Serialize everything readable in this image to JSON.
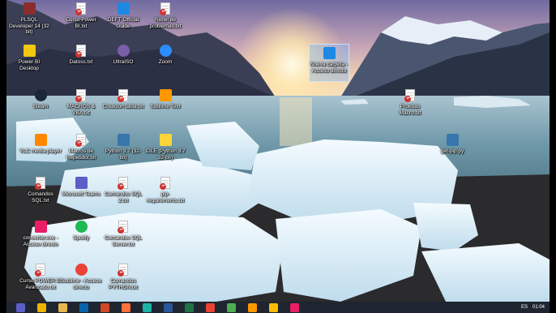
{
  "desktop_icons": [
    {
      "label": "PLSQL Developer 14 (32 bit)",
      "icon": "plsql-icon",
      "color": "#8b2d2d"
    },
    {
      "label": "Curso Power BI.txt",
      "icon": "text-file-icon",
      "color": "#d32f2f"
    },
    {
      "label": "DEFT Official Guide",
      "icon": "shortcut-icon",
      "color": "#1e88e5"
    },
    {
      "label": "Rebel de problemas.txt",
      "icon": "text-file-icon",
      "color": "#d32f2f"
    },
    {
      "label": "Power BI Desktop",
      "icon": "powerbi-icon",
      "color": "#f2c811"
    },
    {
      "label": "Datoss.txt",
      "icon": "text-file-icon",
      "color": "#d32f2f"
    },
    {
      "label": "UltraISO",
      "icon": "ultraiso-icon",
      "color": "#7b5ea7"
    },
    {
      "label": "Zoom",
      "icon": "zoom-icon",
      "color": "#2d8cff"
    },
    {
      "label": "Steam",
      "icon": "steam-icon",
      "color": "#1b2838"
    },
    {
      "label": "MACROS & VBA.txt",
      "icon": "text-file-icon",
      "color": "#d32f2f"
    },
    {
      "label": "Creacion tabla.txt",
      "icon": "text-file-icon",
      "color": "#d32f2f"
    },
    {
      "label": "Sublime Text",
      "icon": "sublime-icon",
      "color": "#ff9800"
    },
    {
      "label": "Pruebas Macro.txt",
      "icon": "text-file-icon",
      "color": "#d32f2f"
    },
    {
      "label": "VLC media player",
      "icon": "vlc-icon",
      "color": "#ff8800"
    },
    {
      "label": "Macros de Repetidor.txt",
      "icon": "text-file-icon",
      "color": "#d32f2f"
    },
    {
      "label": "Python 3.7 (32-bit)",
      "icon": "python-icon",
      "color": "#3776ab"
    },
    {
      "label": "IDLE (Python 3.7 32-bit)",
      "icon": "idle-icon",
      "color": "#ffd43b"
    },
    {
      "label": "get-pip.py",
      "icon": "python-file-icon",
      "color": "#3776ab"
    },
    {
      "label": "Comandos SQL.txt",
      "icon": "text-file-icon",
      "color": "#d32f2f"
    },
    {
      "label": "Microsoft Teams",
      "icon": "teams-icon",
      "color": "#5b5fc7"
    },
    {
      "label": "Comandos SQL 2.txt",
      "icon": "text-file-icon",
      "color": "#d32f2f"
    },
    {
      "label": "pip-requirements.txt",
      "icon": "text-file-icon",
      "color": "#d32f2f"
    },
    {
      "label": "converter.exe - Acceso directo",
      "icon": "converter-icon",
      "color": "#e91e63"
    },
    {
      "label": "Spotify",
      "icon": "spotify-icon",
      "color": "#1db954"
    },
    {
      "label": "Comandos SQL Server.txt",
      "icon": "text-file-icon",
      "color": "#d32f2f"
    },
    {
      "label": "Curso POWER BI Avanzado.txt",
      "icon": "text-file-icon",
      "color": "#d32f2f"
    },
    {
      "label": "Sublime - Acceso directo",
      "icon": "chrome-icon",
      "color": "#ea4335"
    },
    {
      "label": "Comandos PYTHON.txt",
      "icon": "text-file-icon",
      "color": "#d32f2f"
    },
    {
      "label": "Nueva carpeta - Acceso directo",
      "icon": "selected-shortcut-icon",
      "color": "#1e88e5"
    }
  ],
  "taskbar": {
    "apps": [
      {
        "name": "teams-taskbar-icon",
        "color": "#5b5fc7"
      },
      {
        "name": "explorer-taskbar-icon",
        "color": "#f0b400"
      },
      {
        "name": "folder-taskbar-icon",
        "color": "#e6b84d"
      },
      {
        "name": "outlook-taskbar-icon",
        "color": "#0a64ad"
      },
      {
        "name": "powerpoint-taskbar-icon",
        "color": "#d24726"
      },
      {
        "name": "firefox-taskbar-icon",
        "color": "#ff7139"
      },
      {
        "name": "edge-taskbar-icon",
        "color": "#1db3a6"
      },
      {
        "name": "word-taskbar-icon",
        "color": "#2b579a"
      },
      {
        "name": "excel-taskbar-icon",
        "color": "#217346"
      },
      {
        "name": "chrome-taskbar-icon",
        "color": "#ea4335"
      },
      {
        "name": "tv-taskbar-icon",
        "color": "#4caf50"
      },
      {
        "name": "sublime-taskbar-icon",
        "color": "#ff9800"
      },
      {
        "name": "chrome2-taskbar-icon",
        "color": "#fbbc05"
      },
      {
        "name": "app-taskbar-icon",
        "color": "#e91e63"
      }
    ],
    "language": "ES",
    "time": "01:04"
  }
}
